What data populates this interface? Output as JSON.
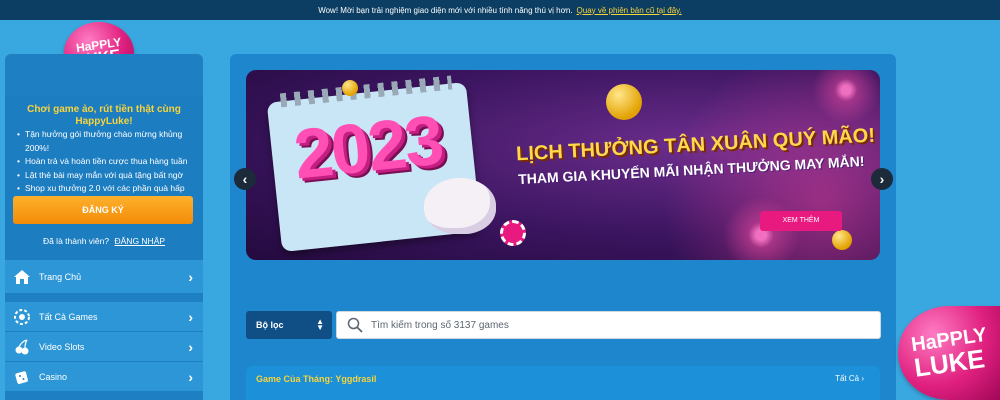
{
  "topbar": {
    "message": "Wow! Mời bạn trải nghiệm giao diện mới với nhiều tính năng thú vị hơn.",
    "link": "Quay về phiên bản cũ tại đây."
  },
  "logo": {
    "line1": "HaPPLY",
    "line2": "LUKE"
  },
  "promo": {
    "title": "Chơi game ảo, rút tiền thật cùng HappyLuke!",
    "items": [
      "Tận hưởng gói thưởng chào mừng khủng 200%!",
      "Hoàn trả và hoàn tiền cược thua hàng tuần",
      "Lật thẻ bài may mắn với quà tặng bất ngờ",
      "Shop xu thưởng 2.0 với các phần quà hấp dẫn"
    ],
    "register_label": "ĐĂNG KÝ",
    "member_text": "Đã là thành viên?",
    "login_label": "ĐĂNG NHẬP"
  },
  "nav": {
    "items": [
      {
        "label": "Trang Chủ",
        "icon": "home-icon"
      },
      {
        "label": "Tất Cả Games",
        "icon": "chip-icon"
      },
      {
        "label": "Video Slots",
        "icon": "cherries-icon"
      },
      {
        "label": "Casino",
        "icon": "dice-icon"
      }
    ]
  },
  "banner": {
    "year": "2023",
    "headline1": "LỊCH THƯỞNG TÂN XUÂN QUÝ MÃO!",
    "headline2": "THAM GIA KHUYẾN MÃI NHẬN THƯỞNG MAY MẮN!",
    "cta": "XEM THÊM"
  },
  "carousel": {
    "prev": "‹",
    "next": "›"
  },
  "filter": {
    "label": "Bộ lọc"
  },
  "search": {
    "placeholder": "Tìm kiếm trong số 3137 games"
  },
  "games_section": {
    "title": "Game Của Tháng: Yggdrasil",
    "see_all": "Tất Cả"
  },
  "colors": {
    "accent_yellow": "#f7d43b",
    "register_orange": "#f59a12",
    "brand_pink": "#e0207f",
    "page_blue": "#3aa8e0"
  }
}
